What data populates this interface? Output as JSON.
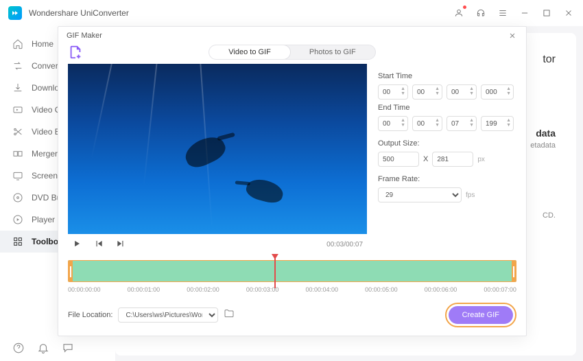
{
  "app": {
    "title": "Wondershare UniConverter"
  },
  "sidebar": {
    "items": [
      {
        "label": "Home"
      },
      {
        "label": "Converter"
      },
      {
        "label": "Downloader"
      },
      {
        "label": "Video Compressor"
      },
      {
        "label": "Video Editor"
      },
      {
        "label": "Merger"
      },
      {
        "label": "Screen Recorder"
      },
      {
        "label": "DVD Burner"
      },
      {
        "label": "Player"
      },
      {
        "label": "Toolbox"
      }
    ]
  },
  "bg": {
    "title_suffix": "tor",
    "meta_title": "data",
    "meta_sub": "etadata",
    "body_suffix": "CD."
  },
  "modal": {
    "title": "GIF Maker",
    "tabs": {
      "video": "Video to GIF",
      "photos": "Photos to GIF"
    },
    "timecode": "00:03/00:07",
    "start_label": "Start Time",
    "end_label": "End Time",
    "start": {
      "h": "00",
      "m": "00",
      "s": "00",
      "ms": "000"
    },
    "end": {
      "h": "00",
      "m": "00",
      "s": "07",
      "ms": "199"
    },
    "output_label": "Output Size:",
    "output": {
      "w": "500",
      "h": "281",
      "sep": "X",
      "unit": "px"
    },
    "frame_label": "Frame Rate:",
    "frame": {
      "value": "29",
      "unit": "fps"
    },
    "ticks": [
      "00:00:00:00",
      "00:00:01:00",
      "00:00:02:00",
      "00:00:03:00",
      "00:00:04:00",
      "00:00:05:00",
      "00:00:06:00",
      "00:00:07:00"
    ],
    "loc_label": "File Location:",
    "loc_value": "C:\\Users\\ws\\Pictures\\Wonders",
    "create_label": "Create GIF"
  }
}
